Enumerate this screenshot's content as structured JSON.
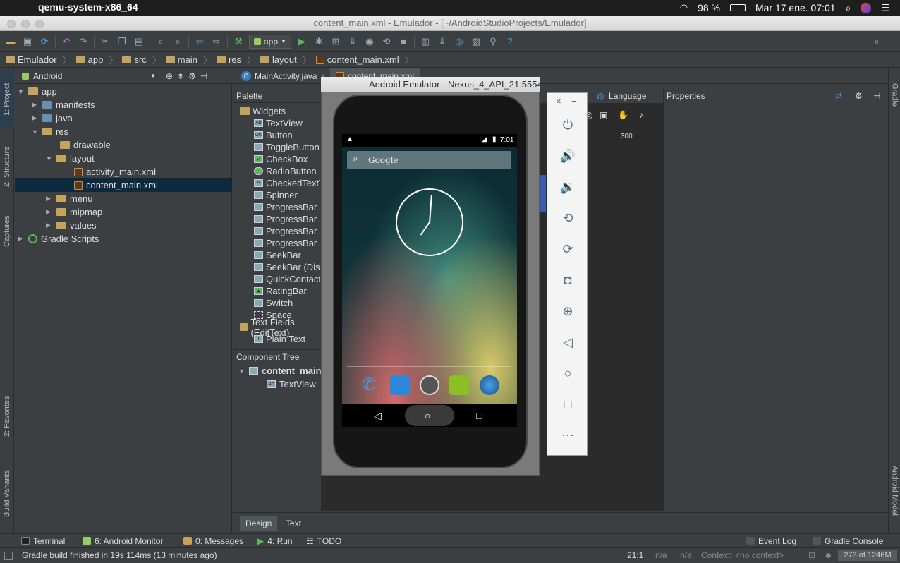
{
  "menubar": {
    "app_name": "qemu-system-x86_64",
    "battery": "98 %",
    "datetime": "Mar 17 ene.  07:01"
  },
  "window": {
    "title": "content_main.xml - Emulador - [~/AndroidStudioProjects/Emulador]"
  },
  "toolbar": {
    "run_config": "app"
  },
  "breadcrumb": [
    "Emulador",
    "app",
    "src",
    "main",
    "res",
    "layout",
    "content_main.xml"
  ],
  "left_stripe": {
    "project": "1: Project",
    "structure": "Z: Structure",
    "captures": "Captures",
    "favorites": "2: Favorites",
    "build_variants": "Build Variants"
  },
  "right_stripe": {
    "gradle": "Gradle",
    "android_model": "Android Model"
  },
  "project": {
    "view_mode": "Android",
    "tree": {
      "app": "app",
      "manifests": "manifests",
      "java": "java",
      "res": "res",
      "drawable": "drawable",
      "layout": "layout",
      "activity_main": "activity_main.xml",
      "content_main": "content_main.xml",
      "menu": "menu",
      "mipmap": "mipmap",
      "values": "values",
      "gradle": "Gradle Scripts"
    }
  },
  "editor_tabs": {
    "tab1": "MainActivity.java",
    "tab2": "content_main.xml"
  },
  "palette": {
    "title": "Palette",
    "widgets_cat": "Widgets",
    "items": [
      "TextView",
      "Button",
      "ToggleButton",
      "CheckBox",
      "RadioButton",
      "CheckedTextView",
      "Spinner",
      "ProgressBar (Large)",
      "ProgressBar",
      "ProgressBar (Small)",
      "ProgressBar (Horizontal)",
      "SeekBar",
      "SeekBar (Discrete)",
      "QuickContactBadge",
      "RatingBar",
      "Switch",
      "Space"
    ],
    "textfields_cat": "Text Fields (EditText)",
    "plain_text": "Plain Text"
  },
  "component_tree": {
    "title": "Component Tree",
    "root": "content_main",
    "child": "TextView"
  },
  "designer": {
    "language": "Language",
    "ruler_300": "300"
  },
  "properties": {
    "title": "Properties"
  },
  "design_tabs": {
    "design": "Design",
    "text": "Text"
  },
  "emulator": {
    "title": "Android Emulator - Nexus_4_API_21:5554",
    "status_time": "7:01",
    "search_hint": "Google"
  },
  "bottom_tools": {
    "terminal": "Terminal",
    "android_monitor": "6: Android Monitor",
    "messages": "0: Messages",
    "run": "4: Run",
    "todo": "TODO",
    "event_log": "Event Log",
    "gradle_console": "Gradle Console"
  },
  "status": {
    "message": "Gradle build finished in 19s 114ms (13 minutes ago)",
    "position": "21:1",
    "na1": "n/a",
    "na2": "n/a",
    "context": "Context: <no context>",
    "memory": "273 of 1246M"
  }
}
